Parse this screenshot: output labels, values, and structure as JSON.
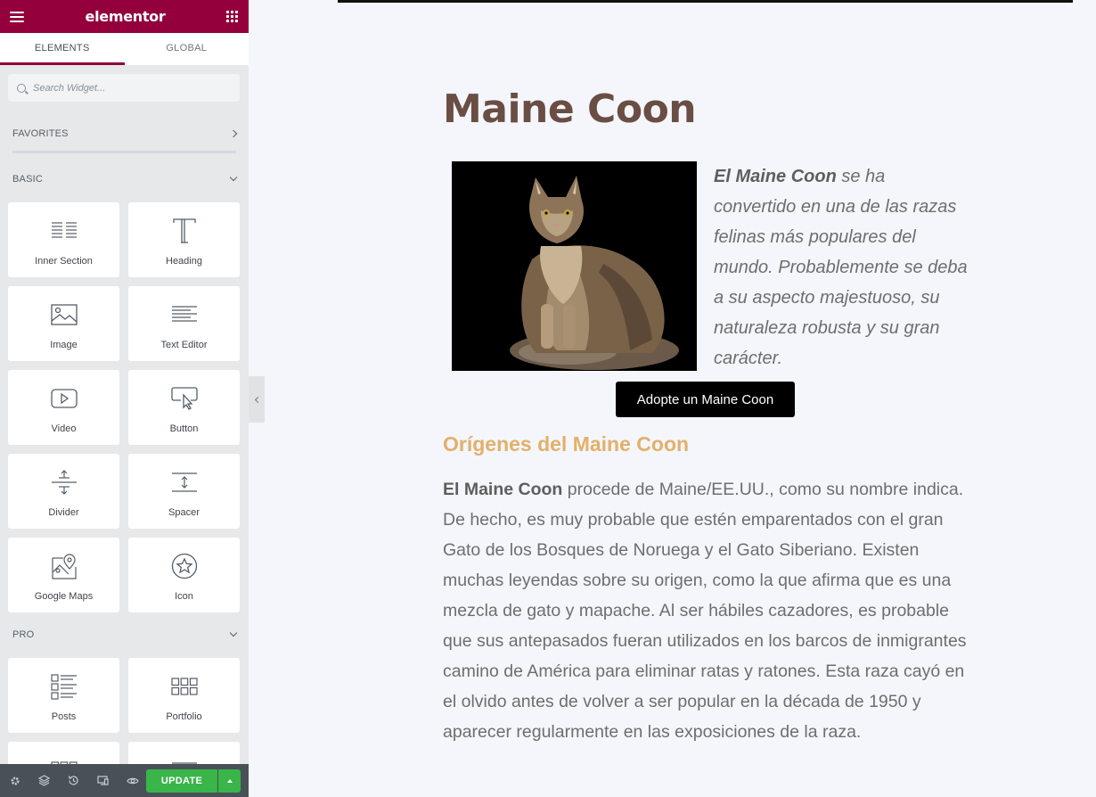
{
  "editor": {
    "brand": "elementor",
    "tabs": [
      "ELEMENTS",
      "GLOBAL"
    ],
    "search_placeholder": "Search Widget...",
    "categories": {
      "favorites": "FAVORITES",
      "basic": "BASIC",
      "pro": "PRO"
    },
    "basic_widgets": [
      {
        "label": "Inner Section",
        "icon": "inner-section-icon"
      },
      {
        "label": "Heading",
        "icon": "heading-icon"
      },
      {
        "label": "Image",
        "icon": "image-icon"
      },
      {
        "label": "Text Editor",
        "icon": "text-editor-icon"
      },
      {
        "label": "Video",
        "icon": "video-icon"
      },
      {
        "label": "Button",
        "icon": "button-icon"
      },
      {
        "label": "Divider",
        "icon": "divider-icon"
      },
      {
        "label": "Spacer",
        "icon": "spacer-icon"
      },
      {
        "label": "Google Maps",
        "icon": "google-maps-icon"
      },
      {
        "label": "Icon",
        "icon": "star-icon"
      }
    ],
    "pro_widgets": [
      {
        "label": "Posts",
        "icon": "posts-icon"
      },
      {
        "label": "Portfolio",
        "icon": "portfolio-icon"
      }
    ],
    "bottom_bar": {
      "update_label": "UPDATE",
      "icons": [
        "settings-icon",
        "layers-icon",
        "history-icon",
        "responsive-icon",
        "preview-icon"
      ]
    },
    "colors": {
      "brand": "#93003c",
      "update": "#39b54a"
    }
  },
  "page": {
    "title": "Maine Coon",
    "intro_bold": "El Maine Coon",
    "intro_rest": " se ha convertido en una de las razas felinas más populares del mundo. Probablemente se deba a su aspecto majestuoso, su naturaleza robusta y su gran carácter.",
    "button_label": "Adopte un Maine Coon",
    "section_heading": "Orígenes del Maine Coon",
    "body_bold": "El Maine Coon",
    "body_rest": " procede de Maine/EE.UU., como su nombre indica. De hecho, es muy probable que estén emparentados con el gran Gato de los Bosques de Noruega y el Gato Siberiano. Existen muchas leyendas sobre su origen, como la que afirma que es una mezcla de gato y mapache. Al ser hábiles cazadores, es probable que sus antepasados fueran utilizados en los barcos de inmigrantes camino de América para eliminar ratas y ratones. Esta raza cayó en el olvido antes de volver a ser popular en la década de 1950 y aparecer regularmente en las exposiciones de la raza.",
    "colors": {
      "title": "#6a4e43",
      "section_heading": "#e3b06a",
      "button": "#000000"
    }
  }
}
